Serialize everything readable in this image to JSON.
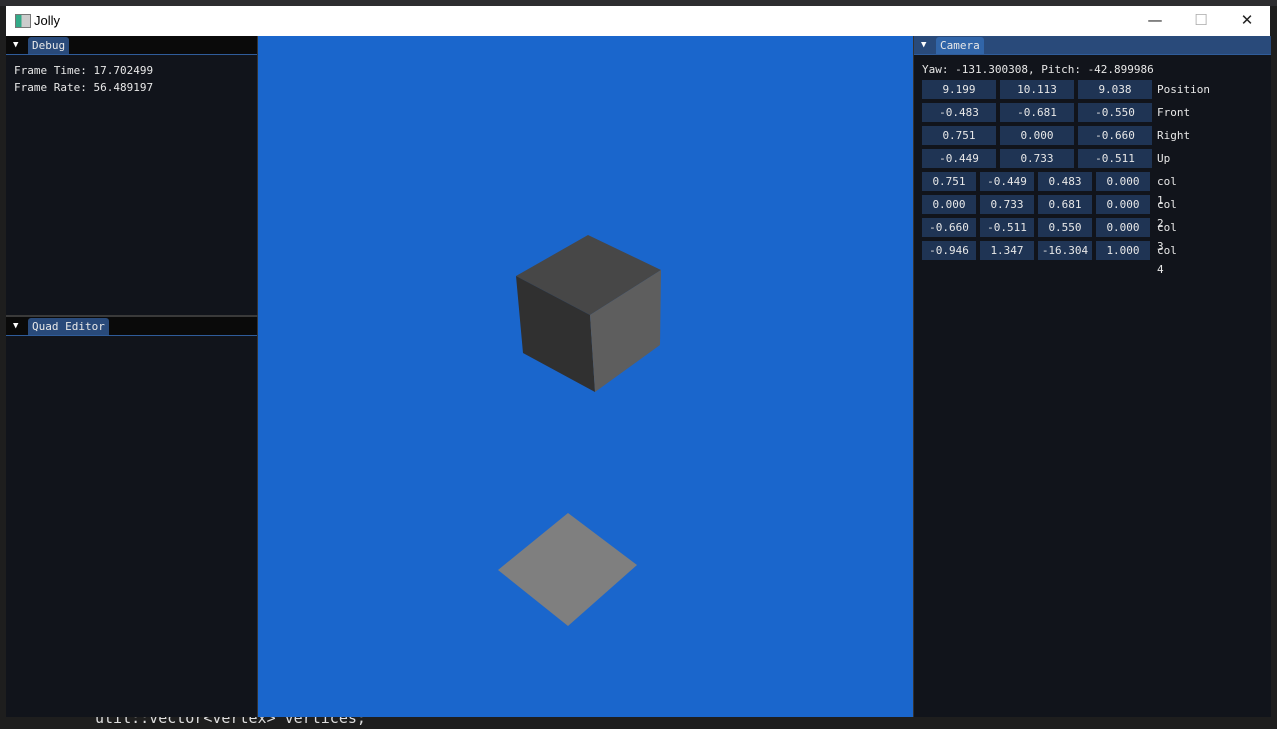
{
  "background_code": "util::vector<vertex> vertices;",
  "window": {
    "title": "Jolly",
    "minimize": "—",
    "maximize": "☐",
    "close": "✕"
  },
  "debug": {
    "tab": "Debug",
    "frame_time": "Frame Time: 17.702499",
    "frame_rate": "Frame Rate: 56.489197"
  },
  "quad_editor": {
    "tab": "Quad Editor"
  },
  "camera": {
    "tab": "Camera",
    "yaw_pitch": "Yaw: -131.300308, Pitch: -42.899986",
    "vectors": [
      {
        "label": "Position",
        "values": [
          "9.199",
          "10.113",
          "9.038"
        ]
      },
      {
        "label": "Front",
        "values": [
          "-0.483",
          "-0.681",
          "-0.550"
        ]
      },
      {
        "label": "Right",
        "values": [
          "0.751",
          "0.000",
          "-0.660"
        ]
      },
      {
        "label": "Up",
        "values": [
          "-0.449",
          "0.733",
          "-0.511"
        ]
      }
    ],
    "matrix": [
      {
        "label": "col 1",
        "values": [
          "0.751",
          "-0.449",
          "0.483",
          "0.000"
        ]
      },
      {
        "label": "col 2",
        "values": [
          "0.000",
          "0.733",
          "0.681",
          "0.000"
        ]
      },
      {
        "label": "col 3",
        "values": [
          "-0.660",
          "-0.511",
          "0.550",
          "0.000"
        ]
      },
      {
        "label": "col 4",
        "values": [
          "-0.946",
          "1.347",
          "-16.304",
          "1.000"
        ]
      }
    ]
  },
  "colors": {
    "viewport": "#1a66cc",
    "panel": "#11141b",
    "accent": "#294a7a"
  }
}
